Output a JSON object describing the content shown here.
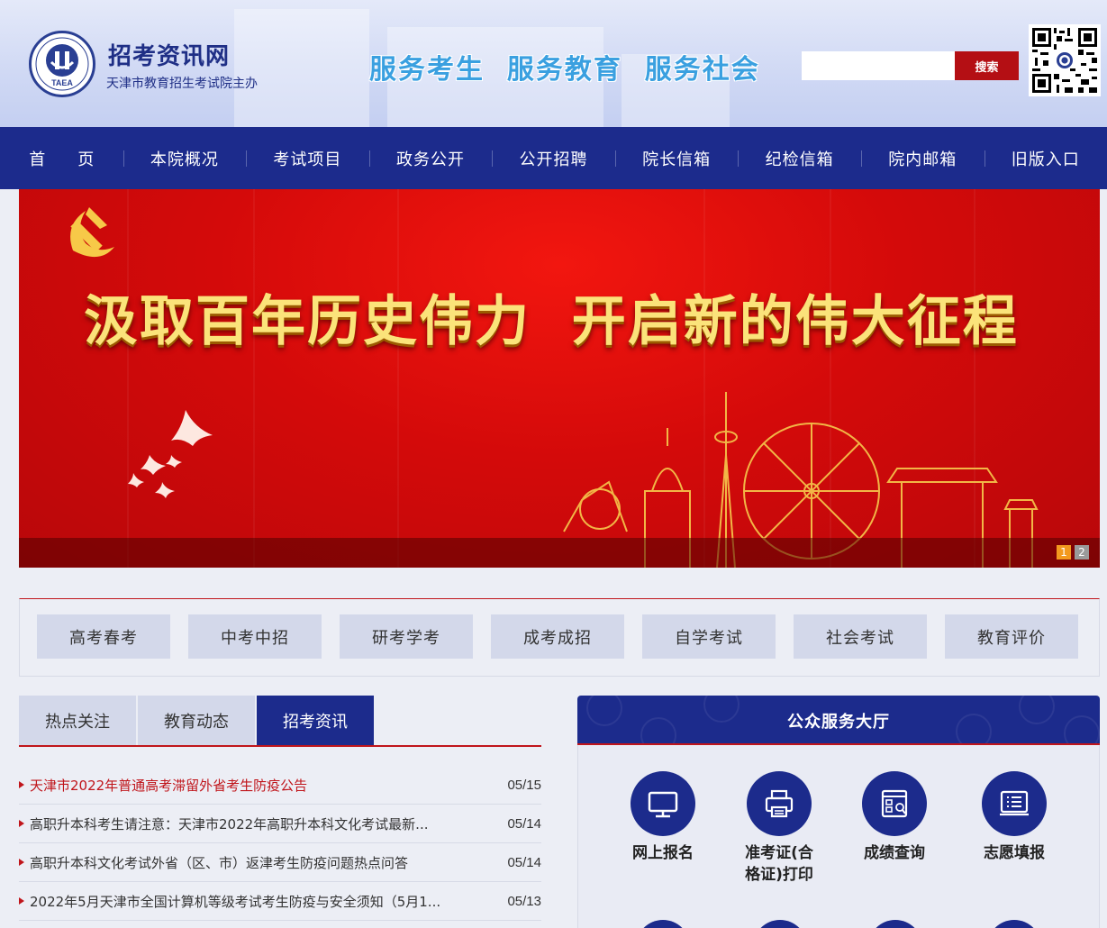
{
  "header": {
    "site_title": "招考资讯网",
    "site_subtitle": "天津市教育招生考试院主办",
    "logo_text": "TAEA",
    "slogan": "服务考生  服务教育  服务社会",
    "search_placeholder": "",
    "search_button": "搜索"
  },
  "nav": {
    "items": [
      "首　　页",
      "本院概况",
      "考试项目",
      "政务公开",
      "公开招聘",
      "院长信箱",
      "纪检信箱",
      "院内邮箱",
      "旧版入口"
    ]
  },
  "banner": {
    "title": "汲取百年历史伟力  开启新的伟大征程",
    "pages": [
      "1",
      "2"
    ],
    "active_page": 1
  },
  "categories": [
    "高考春考",
    "中考中招",
    "研考学考",
    "成考成招",
    "自学考试",
    "社会考试",
    "教育评价"
  ],
  "news_tabs": {
    "tabs": [
      "热点关注",
      "教育动态",
      "招考资讯"
    ],
    "active_index": 2
  },
  "news": [
    {
      "title": "天津市2022年普通高考滞留外省考生防疫公告",
      "date": "05/15",
      "hot": true
    },
    {
      "title": "高职升本科考生请注意：天津市2022年高职升本科文化考试最新...",
      "date": "05/14",
      "hot": false
    },
    {
      "title": "高职升本科文化考试外省（区、市）返津考生防疫问题热点问答",
      "date": "05/14",
      "hot": false
    },
    {
      "title": "2022年5月天津市全国计算机等级考试考生防疫与安全须知（5月1...",
      "date": "05/13",
      "hot": false
    }
  ],
  "service_hall": {
    "title": "公众服务大厅",
    "items": [
      {
        "label": "网上报名",
        "icon": "monitor-icon"
      },
      {
        "label": "准考证(合格证)打印",
        "icon": "printer-icon"
      },
      {
        "label": "成绩查询",
        "icon": "score-query-icon"
      },
      {
        "label": "志愿填报",
        "icon": "application-icon"
      }
    ]
  },
  "colors": {
    "nav_blue": "#1c2b8c",
    "accent_red": "#c0151b",
    "banner_red": "#d40a0a",
    "banner_gold": "#fbe37a",
    "slogan_blue": "#3aa0e0"
  }
}
